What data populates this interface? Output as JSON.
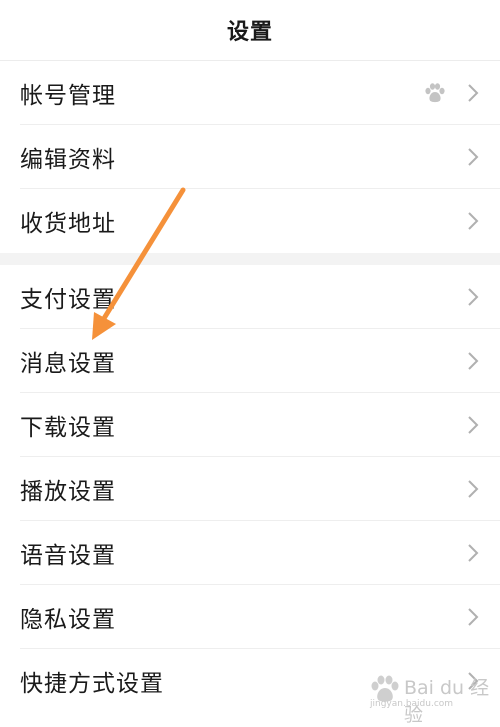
{
  "header": {
    "title": "设置"
  },
  "groups": [
    {
      "items": [
        {
          "label": "帐号管理",
          "icon": "baidu-paw-icon"
        },
        {
          "label": "编辑资料"
        },
        {
          "label": "收货地址"
        }
      ]
    },
    {
      "items": [
        {
          "label": "支付设置"
        },
        {
          "label": "消息设置"
        },
        {
          "label": "下载设置"
        },
        {
          "label": "播放设置"
        },
        {
          "label": "语音设置"
        },
        {
          "label": "隐私设置"
        },
        {
          "label": "快捷方式设置"
        }
      ]
    }
  ],
  "colors": {
    "annotation_arrow": "#f5913a",
    "chevron": "#b0b0b0",
    "divider": "#eeeeee",
    "section_gap": "#f3f3f3"
  },
  "watermark": {
    "text": "Bai du 经验",
    "sub": "jingyan.baidu.com"
  }
}
